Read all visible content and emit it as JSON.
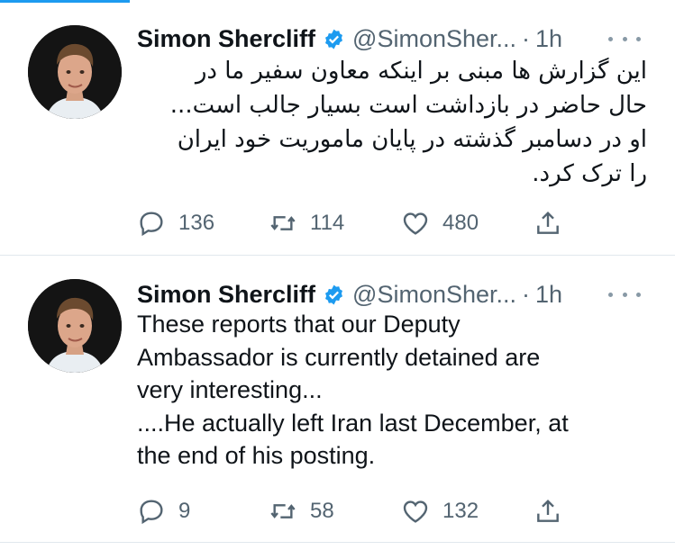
{
  "tweets": [
    {
      "name": "Simon Shercliff",
      "handle": "@SimonSher...",
      "separator": "·",
      "time": "1h",
      "text": "این گزارش ها مبنی بر اینکه معاون سفیر ما در\nحال حاضر در بازداشت است بسیار جالب است...\nاو در دسامبر گذشته در پایان ماموریت خود ایران\nرا ترک کرد.",
      "replies": "136",
      "retweets": "114",
      "likes": "480"
    },
    {
      "name": "Simon Shercliff",
      "handle": "@SimonSher...",
      "separator": "·",
      "time": "1h",
      "text": "These reports that our Deputy\nAmbassador is currently detained are\nvery interesting...\n....He actually left Iran last December, at\nthe end of his posting.",
      "replies": "9",
      "retweets": "58",
      "likes": "132"
    }
  ],
  "colors": {
    "accent": "#1d9bf0",
    "muted": "#536471",
    "divider": "#e1e8ed"
  },
  "icons": [
    "verified-badge-icon",
    "more-icon",
    "reply-icon",
    "retweet-icon",
    "like-icon",
    "share-icon"
  ]
}
